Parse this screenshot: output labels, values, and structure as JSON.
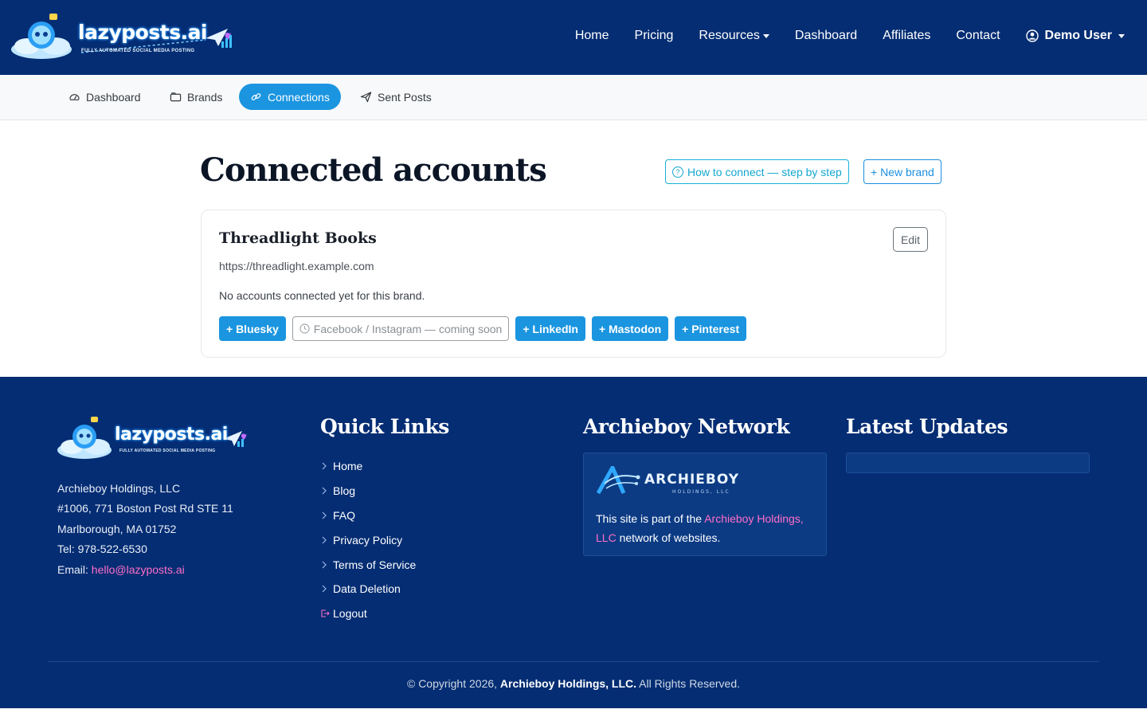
{
  "navbar": {
    "logo_text": "lazyposts.ai",
    "logo_tagline": "FULLY AUTOMATED SOCIAL MEDIA POSTING",
    "links": [
      "Home",
      "Pricing",
      "Resources",
      "Dashboard",
      "Affiliates",
      "Contact"
    ],
    "user": "Demo User"
  },
  "subnav": {
    "items": [
      {
        "label": "Dashboard",
        "icon": "speedometer-icon"
      },
      {
        "label": "Brands",
        "icon": "folder-icon"
      },
      {
        "label": "Connections",
        "icon": "link-icon",
        "active": true
      },
      {
        "label": "Sent Posts",
        "icon": "send-icon"
      }
    ]
  },
  "main": {
    "title": "Connected accounts",
    "how_to_label": "How to connect — step by step",
    "new_brand_label": "+ New brand"
  },
  "brand": {
    "name": "Threadlight Books",
    "edit_label": "Edit",
    "url": "https://threadlight.example.com",
    "empty_text": "No accounts connected yet for this brand.",
    "connect_buttons": [
      "+ Bluesky",
      "Facebook / Instagram — coming soon",
      "+ LinkedIn",
      "+ Mastodon",
      "+ Pinterest"
    ]
  },
  "footer": {
    "logo_text": "lazyposts.ai",
    "logo_tagline": "FULLY AUTOMATED SOCIAL MEDIA POSTING",
    "address_lines": [
      "Archieboy Holdings, LLC",
      "#1006, 771 Boston Post Rd STE 11",
      "Marlborough, MA 01752",
      "Tel: 978-522-6530"
    ],
    "email_label": "Email:",
    "email": "hello@lazyposts.ai",
    "quick_links_heading": "Quick Links",
    "quick_links": [
      "Home",
      "Blog",
      "FAQ",
      "Privacy Policy",
      "Terms of Service",
      "Data Deletion",
      "Logout"
    ],
    "network_heading": "Archieboy Network",
    "network_logo_text": "ARCHIEBOY",
    "network_logo_sub": "HOLDINGS, LLC",
    "network_text_pre": "This site is part of the",
    "network_link": "Archieboy Holdings, LLC",
    "network_text_post": "network of websites.",
    "updates_heading": "Latest Updates",
    "copyright_pre": "© Copyright 2026,",
    "copyright_company": "Archieboy Holdings, LLC.",
    "copyright_post": "All Rights Reserved."
  },
  "colors": {
    "navy": "#042d73",
    "accent_blue": "#1b95e0",
    "pink_link": "#ff6ec7"
  }
}
